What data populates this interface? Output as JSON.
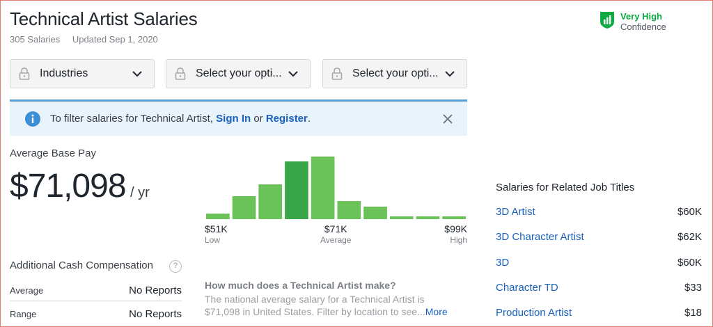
{
  "header": {
    "title": "Technical Artist Salaries",
    "salary_count": "305 Salaries",
    "updated": "Updated Sep 1, 2020"
  },
  "confidence": {
    "level": "Very High",
    "label": "Confidence",
    "icon": "shield-bar-chart-icon",
    "color": "#0caa41"
  },
  "filters": [
    {
      "label": "Industries",
      "icon": "lock-icon"
    },
    {
      "label": "Select your opti...",
      "icon": "lock-icon"
    },
    {
      "label": "Select your opti...",
      "icon": "lock-icon"
    }
  ],
  "banner": {
    "text_before": "To filter salaries for Technical Artist, ",
    "sign_in": "Sign In",
    "middle": " or ",
    "register": "Register",
    "text_after": "."
  },
  "average": {
    "label": "Average Base Pay",
    "amount": "$71,098",
    "per": "/ yr"
  },
  "chart_data": {
    "type": "bar",
    "title": "",
    "values": [
      8,
      33,
      50,
      83,
      90,
      26,
      18,
      4,
      4,
      4
    ],
    "highlight_index": 3,
    "bar_color": "#6ac259",
    "highlight_color": "#3aa64a",
    "ylim": [
      0,
      95
    ],
    "tick_labels": [
      {
        "value": "$51K",
        "sub": "Low"
      },
      {
        "value": "$71K",
        "sub": "Average"
      },
      {
        "value": "$99K",
        "sub": "High"
      }
    ]
  },
  "additional": {
    "title": "Additional Cash Compensation",
    "help": "?",
    "rows": [
      {
        "label": "Average",
        "value": "No Reports"
      },
      {
        "label": "Range",
        "value": "No Reports"
      }
    ]
  },
  "faq": {
    "question": "How much does a Technical Artist make?",
    "answer": "The national average salary for a Technical Artist is $71,098 in United States. Filter by location to see...",
    "more": "More"
  },
  "related": {
    "title": "Salaries for Related Job Titles",
    "items": [
      {
        "title": "3D Artist",
        "salary": "$60K"
      },
      {
        "title": "3D Character Artist",
        "salary": "$62K"
      },
      {
        "title": "3D",
        "salary": "$60K"
      },
      {
        "title": "Character TD",
        "salary": "$33"
      },
      {
        "title": "Production Artist",
        "salary": "$18"
      }
    ]
  }
}
